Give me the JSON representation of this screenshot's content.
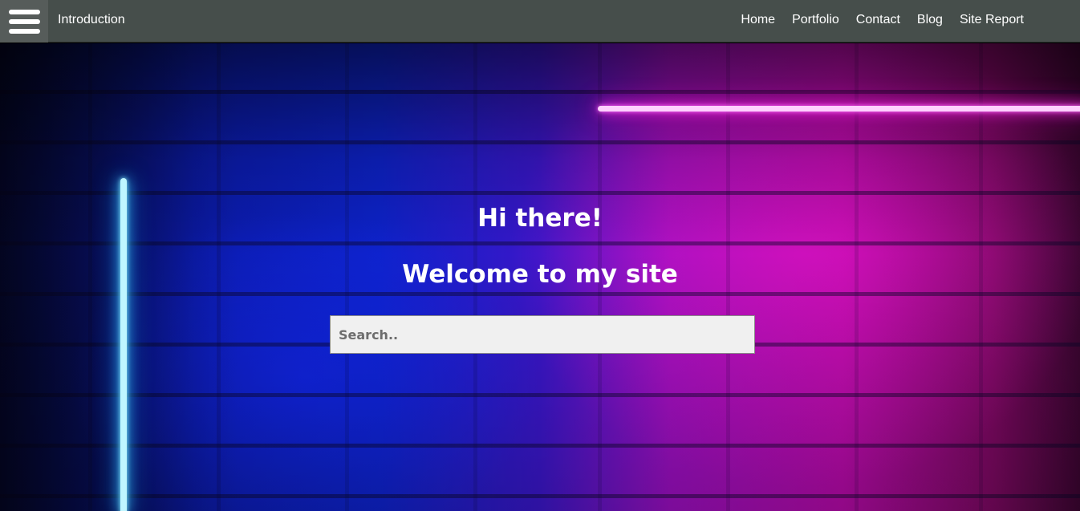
{
  "navbar": {
    "brand": "Introduction",
    "menu_icon": "hamburger-menu-icon",
    "links": [
      "Home",
      "Portfolio",
      "Contact",
      "Blog",
      "Site Report"
    ],
    "background_color": "#464e4b"
  },
  "hero": {
    "greeting": "Hi there!",
    "welcome": "Welcome to my site",
    "search": {
      "placeholder": "Search..",
      "value": ""
    },
    "accent_colors": {
      "blue": "#0d22c8",
      "magenta": "#b50aa8",
      "neon_cyan": "#8ff0ff",
      "neon_pink": "#ff2ee8"
    }
  }
}
